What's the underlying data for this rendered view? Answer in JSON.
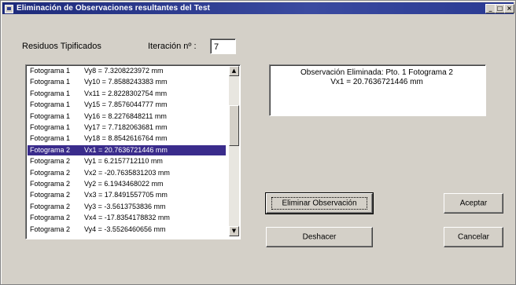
{
  "window": {
    "title": "Eliminación de Observaciones resultantes del Test",
    "controls": {
      "minimize": "_",
      "maximize": "□",
      "close": "×"
    }
  },
  "form": {
    "residuos_label": "Residuos Tipificados",
    "iteracion_label": "Iteración nº :",
    "iteracion_value": "7"
  },
  "residual_list": {
    "selected_index": 7,
    "items": [
      {
        "photo": "Fotograma 1",
        "value": "Vy8 = 7.3208223972  mm"
      },
      {
        "photo": "Fotograma 1",
        "value": "Vy10 = 7.8588243383  mm"
      },
      {
        "photo": "Fotograma 1",
        "value": "Vx11 = 2.8228302754  mm"
      },
      {
        "photo": "Fotograma 1",
        "value": "Vy15 = 7.8576044777  mm"
      },
      {
        "photo": "Fotograma 1",
        "value": "Vy16 = 8.2276848211  mm"
      },
      {
        "photo": "Fotograma 1",
        "value": "Vy17 = 7.7182063681  mm"
      },
      {
        "photo": "Fotograma 1",
        "value": "Vy18 = 8.8542616764  mm"
      },
      {
        "photo": "Fotograma 2",
        "value": "Vx1 = 20.7636721446  mm"
      },
      {
        "photo": "Fotograma 2",
        "value": "Vy1 = 6.2157712110  mm"
      },
      {
        "photo": "Fotograma 2",
        "value": "Vx2 = -20.7635831203  mm"
      },
      {
        "photo": "Fotograma 2",
        "value": "Vy2 = 6.1943468022  mm"
      },
      {
        "photo": "Fotograma 2",
        "value": "Vx3 = 17.8491557705  mm"
      },
      {
        "photo": "Fotograma 2",
        "value": "Vy3 = -3.5613753836  mm"
      },
      {
        "photo": "Fotograma 2",
        "value": "Vx4 = -17.8354178832  mm"
      },
      {
        "photo": "Fotograma 2",
        "value": "Vy4 = -3.5526460656  mm"
      }
    ],
    "scroll_up": "▲",
    "scroll_down": "▼"
  },
  "observation": {
    "line1": "Observación Eliminada:   Pto. 1    Fotograma 2",
    "line2": "Vx1 = 20.7636721446  mm"
  },
  "buttons": {
    "eliminar": "Eliminar Observación",
    "deshacer": "Deshacer",
    "aceptar": "Aceptar",
    "cancelar": "Cancelar"
  },
  "colors": {
    "selection": "#3a2c8c",
    "titlebar": "#1d2a7a",
    "face": "#d4d0c8"
  }
}
